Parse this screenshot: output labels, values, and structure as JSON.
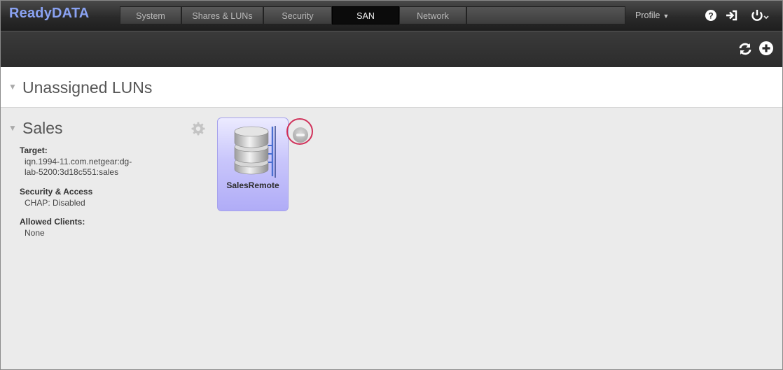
{
  "app": {
    "logo": "ReadyDATA"
  },
  "nav": {
    "tabs": [
      {
        "label": "System"
      },
      {
        "label": "Shares & LUNs"
      },
      {
        "label": "Security"
      },
      {
        "label": "SAN"
      },
      {
        "label": "Network"
      }
    ],
    "active": "SAN",
    "profile_label": "Profile",
    "icons": [
      "help-icon",
      "logout-icon",
      "power-icon"
    ]
  },
  "toolbar": {
    "icons": [
      "refresh-icon",
      "add-icon"
    ]
  },
  "unassigned": {
    "title": "Unassigned LUNs"
  },
  "group": {
    "title": "Sales",
    "target_label": "Target:",
    "target_value_line1": "iqn.1994-11.com.netgear:dg-",
    "target_value_line2": "lab-5200:3d18c551:sales",
    "security_label": "Security & Access",
    "security_value": "CHAP: Disabled",
    "clients_label": "Allowed Clients:",
    "clients_value": "None",
    "lun": {
      "name": "SalesRemote"
    }
  },
  "colors": {
    "logo": "#8aa2f2",
    "lun_card": "#c0bdfa",
    "highlight_circle": "#d0315a"
  }
}
